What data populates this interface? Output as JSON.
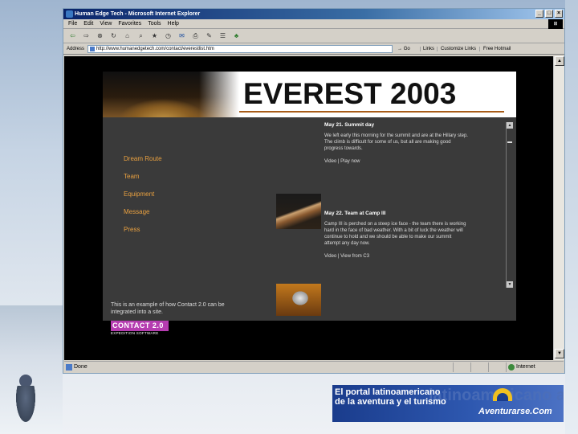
{
  "window": {
    "title": "Human Edge Tech - Microsoft Internet Explorer",
    "controls": [
      "_",
      "□",
      "×"
    ]
  },
  "menu": [
    "File",
    "Edit",
    "View",
    "Favorites",
    "Tools",
    "Help"
  ],
  "address": {
    "label": "Address",
    "url": "http://www.humanedgetech.com/contact/everestlist.htm",
    "go_label": "Go",
    "links_label": "Links",
    "quick_links": [
      "Customize Links",
      "Free Hotmail"
    ]
  },
  "page": {
    "banner_title": "EVEREST 2003",
    "nav": [
      "Dream Route",
      "Team",
      "Equipment",
      "Message",
      "Press"
    ],
    "footnote": "This is an example of how Contact 2.0 can be integrated into a site.",
    "news": [
      {
        "headline": "May 21. Summit day",
        "body": "We left early this morning for the summit and are at the Hillary step. The climb is difficult for some of us, but all are making good progress towards.",
        "link": "Video | Play now"
      },
      {
        "headline": "May 22. Team at Camp III",
        "body": "Camp III is perched on a steep ice face - the team there is working hard in the face of bad weather. With a bit of luck the weather will continue to hold and we should be able to make our summit attempt any day now.",
        "link": "Video | View from C3"
      }
    ],
    "logo_text": "CONTACT 2.0",
    "logo_sub": "EXPEDITION SOFTWARE"
  },
  "status": {
    "left": "Done",
    "zone": "Internet"
  },
  "ad": {
    "line1": "El portal latinoamericano",
    "line2": "de la aventura y el turismo",
    "bg_text": "latinoamericano aventura y",
    "brand": "Aventurarse.Com"
  }
}
